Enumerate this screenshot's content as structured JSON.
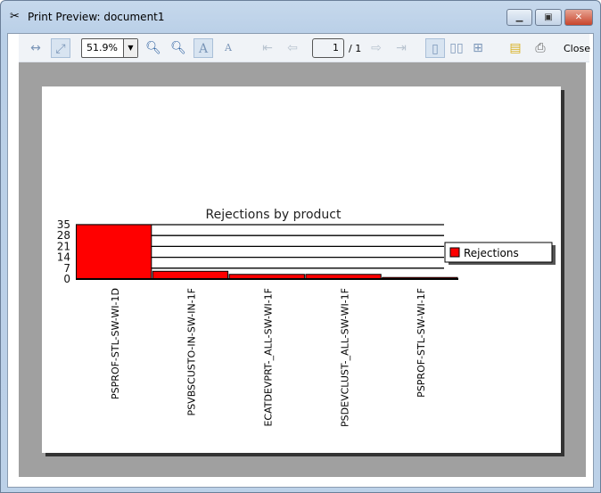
{
  "window": {
    "title": "Print Preview: document1",
    "icon": "print-preview-icon"
  },
  "toolbar": {
    "zoom": "51.9%",
    "page": "1",
    "page_total": "/ 1",
    "close_label": "Close",
    "icons": [
      "fit-width-icon",
      "fit-page-icon",
      "zoom-out-icon",
      "zoom-in-icon",
      "large-text-icon",
      "small-text-icon",
      "first-page-icon",
      "previous-page-icon",
      "next-page-icon",
      "last-page-icon",
      "one-page-icon",
      "two-pages-icon",
      "four-pages-icon",
      "page-setup-icon",
      "print-icon"
    ]
  },
  "chart_data": {
    "type": "bar",
    "title": "Rejections by product",
    "categories": [
      "PSPROF-STL-SW-WI-1D",
      "PSVBSCUSTO-IN-SW-IN-1F",
      "ECATDEVPRT-_ALL-SW-WI-1F",
      "PSDEVCLUST-_ALL-SW-WI-1F",
      "PSPROF-STL-SW-WI-1F"
    ],
    "series": [
      {
        "name": "Rejections",
        "values": [
          35,
          5,
          3,
          3,
          1
        ],
        "color": "#ff0000"
      }
    ],
    "yticks": [
      0,
      7,
      14,
      21,
      28,
      35
    ],
    "ylim": [
      0,
      35
    ],
    "grid": true,
    "legend": "right"
  }
}
